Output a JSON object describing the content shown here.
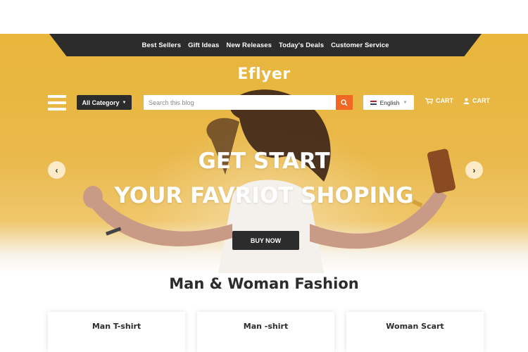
{
  "topnav": {
    "links": [
      "Best Sellers",
      "Gift Ideas",
      "New Releases",
      "Today's Deals",
      "Customer Service"
    ]
  },
  "header": {
    "logo": "Eflyer",
    "category_label": "All Category",
    "search_placeholder": "Search this blog",
    "language": "English",
    "cart_label_1": "CART",
    "cart_label_2": "CART"
  },
  "hero": {
    "title_line1": "GET START",
    "title_line2": "YOUR FAVRIOT SHOPING",
    "cta": "BUY NOW",
    "prev_arrow": "‹",
    "next_arrow": "›"
  },
  "section": {
    "title": "Man & Woman Fashion",
    "cards": [
      "Man T-shirt",
      "Man -shirt",
      "Woman Scart"
    ]
  },
  "colors": {
    "accent": "#f26722",
    "dark": "#2c2c2c",
    "hero_bg": "#e8b63a"
  },
  "icons": [
    "menu-icon",
    "caret-down-icon",
    "search-icon",
    "flag-icon",
    "cart-icon",
    "user-icon",
    "chevron-left-icon",
    "chevron-right-icon"
  ]
}
